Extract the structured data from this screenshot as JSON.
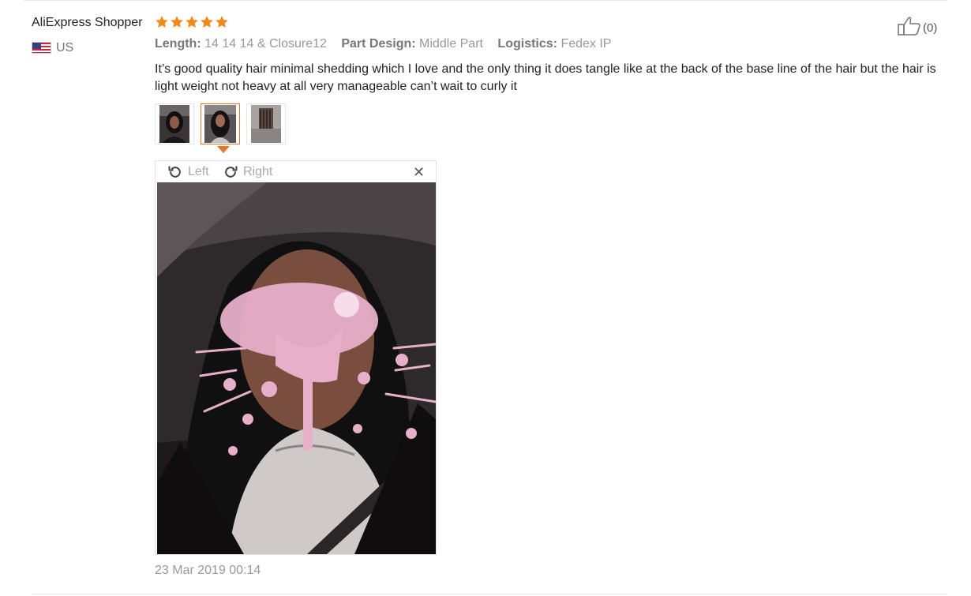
{
  "review": {
    "user_name": "AliExpress Shopper",
    "country": "US",
    "rating": 5,
    "rating_color": "#f08a1a",
    "attributes": [
      {
        "key": "Length:",
        "value": "14 14 14 & Closure12"
      },
      {
        "key": "Part Design:",
        "value": "Middle Part"
      },
      {
        "key": "Logistics:",
        "value": "Fedex IP"
      }
    ],
    "text": "It’s good quality hair minimal shedding which I love and the only thing it does tangle like at the back of the base line of the hair but the hair is light weight not heavy at all very manageable can’t wait to curly it",
    "like_count": "(0)",
    "date": "23 Mar 2019 00:14"
  },
  "gallery": {
    "selected_index": 1,
    "thumb_count": 3,
    "accent_color": "#e6742d"
  },
  "viewer": {
    "rotate_left_label": "Left",
    "rotate_right_label": "Right",
    "close_icon": "close-icon",
    "rotate_left_icon": "rotate-left-icon",
    "rotate_right_icon": "rotate-right-icon"
  }
}
